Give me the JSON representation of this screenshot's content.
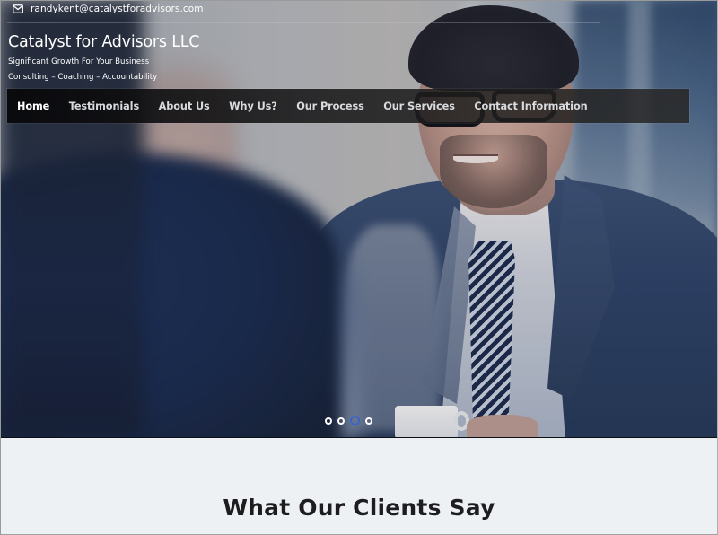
{
  "topbar": {
    "email_icon": "envelope-icon",
    "email": "randykent@catalystforadvisors.com"
  },
  "brand": {
    "title": "Catalyst for Advisors LLC",
    "tagline": "Significant Growth For Your Business",
    "services": "Consulting – Coaching – Accountability"
  },
  "nav": {
    "items": [
      {
        "label": "Home",
        "active": true
      },
      {
        "label": "Testimonials",
        "active": false
      },
      {
        "label": "About Us",
        "active": false
      },
      {
        "label": "Why Us?",
        "active": false
      },
      {
        "label": "Our Process",
        "active": false
      },
      {
        "label": "Our Services",
        "active": false
      },
      {
        "label": "Contact Information",
        "active": false
      }
    ]
  },
  "hero": {
    "image_description": "Smiling businessman in glasses, suit and striped tie facing a blurred person in the foreground",
    "slider": {
      "total_slides": 4,
      "active_slide": 3
    }
  },
  "testimonials": {
    "heading": "What Our Clients Say"
  },
  "colors": {
    "nav_background": "#111113",
    "active_dot": "#3a64c8",
    "section_background": "#eef1f4",
    "heading_text": "#1d1d1f"
  }
}
